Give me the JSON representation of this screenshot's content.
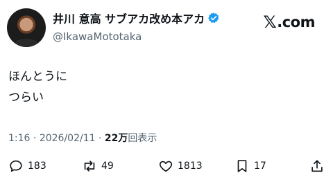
{
  "header": {
    "display_name": "井川 意高 サブアカ改め本アカ",
    "handle": "@IkawaMototaka",
    "brand": ".com"
  },
  "tweet": {
    "lines": [
      "ほんとうに",
      "つらい"
    ]
  },
  "meta": {
    "time": "1:16",
    "separator1": "·",
    "date": "2026/02/11",
    "separator2": "·",
    "views_count": "22万",
    "views_label": "回表示"
  },
  "actions": {
    "replies": "183",
    "retweets": "49",
    "likes": "1813",
    "bookmarks": "17"
  },
  "colors": {
    "verified": "#1d9bf0",
    "secondary_text": "#536471"
  }
}
